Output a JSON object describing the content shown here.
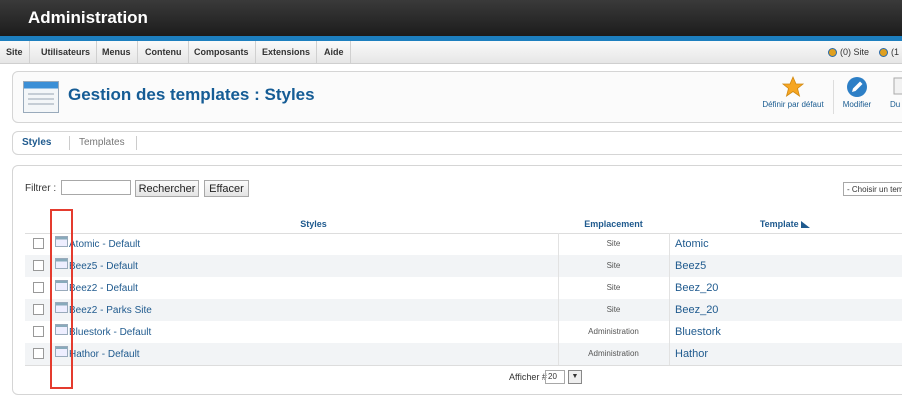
{
  "header": {
    "title": "Administration"
  },
  "menu": {
    "items": [
      "Site",
      "Utilisateurs",
      "Menus",
      "Contenu",
      "Composants",
      "Extensions",
      "Aide"
    ],
    "status_site": "(0) Site",
    "status_admin": "(1"
  },
  "toolbar": {
    "title": "Gestion des templates : Styles",
    "default_label": "Définir par défaut",
    "edit_label": "Modifier",
    "duplicate_label": "Du"
  },
  "tabs": [
    "Styles",
    "Templates"
  ],
  "filter": {
    "label": "Filtrer :",
    "input_value": "",
    "search_button": "Rechercher",
    "clear_button": "Effacer",
    "template_select": "- Choisir un temp"
  },
  "table": {
    "columns": {
      "styles": "Styles",
      "location": "Emplacement",
      "template": "Template"
    },
    "rows": [
      {
        "name": "Atomic - Default",
        "location": "Site",
        "template": "Atomic"
      },
      {
        "name": "Beez5 - Default",
        "location": "Site",
        "template": "Beez5"
      },
      {
        "name": "Beez2 - Default",
        "location": "Site",
        "template": "Beez_20"
      },
      {
        "name": "Beez2 - Parks Site",
        "location": "Site",
        "template": "Beez_20"
      },
      {
        "name": "Bluestork - Default",
        "location": "Administration",
        "template": "Bluestork"
      },
      {
        "name": "Hathor - Default",
        "location": "Administration",
        "template": "Hathor"
      }
    ]
  },
  "pagination": {
    "label": "Afficher #",
    "value": "20"
  },
  "colors": {
    "header": "#1c1c1c",
    "accent": "#1d7fbf",
    "link": "#1f5a8e",
    "highlight": "#e43b2e"
  }
}
